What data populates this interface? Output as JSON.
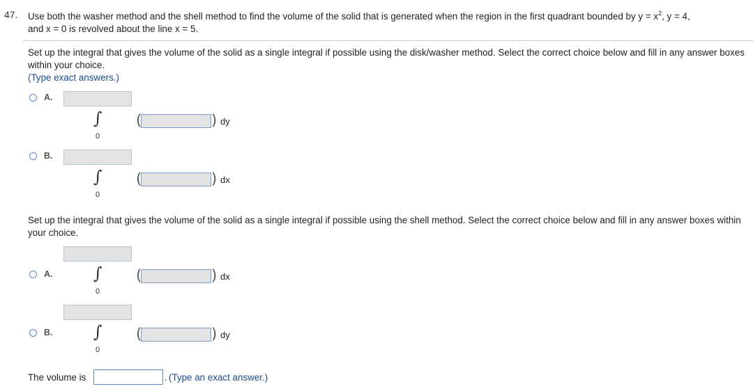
{
  "question": {
    "number": "47.",
    "text_before": "Use both the washer method and the shell method to find the volume of the solid that is generated when the region in the first quadrant bounded by y = x",
    "exp": "2",
    "text_after": ", y = 4,",
    "text_line2": "and x = 0 is revolved about the line x = 5."
  },
  "washer": {
    "instruction": "Set up the integral that gives the volume of the solid as a single integral if possible using the disk/washer method. Select the correct choice below and fill in any answer boxes within your choice.",
    "hint": "(Type exact answers.)",
    "options": [
      {
        "label": "A.",
        "lower": "0",
        "differential": "dy"
      },
      {
        "label": "B.",
        "lower": "0",
        "differential": "dx"
      }
    ]
  },
  "shell": {
    "instruction": "Set up the integral that gives the volume of the solid as a single integral if possible using the shell method. Select the correct choice below and fill in any answer boxes within your choice.",
    "options": [
      {
        "label": "A.",
        "lower": "0",
        "differential": "dx"
      },
      {
        "label": "B.",
        "lower": "0",
        "differential": "dy"
      }
    ]
  },
  "volume": {
    "label": "The volume is",
    "period": ".",
    "hint": "(Type an exact answer.)"
  }
}
